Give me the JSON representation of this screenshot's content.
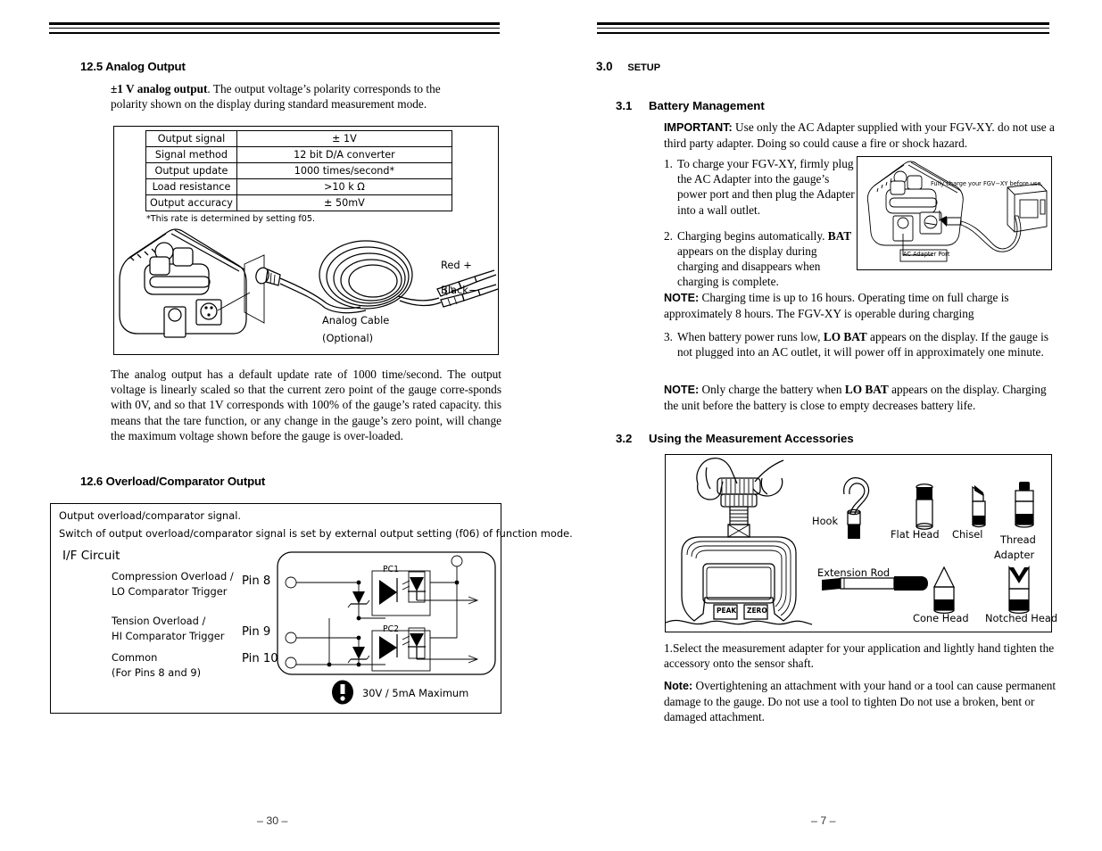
{
  "left_page": {
    "page_number": "– 30 –",
    "section_12_5": {
      "heading": "12.5 Analog Output",
      "intro_bold": "±1 V analog output",
      "intro_rest": ". The output voltage’s polarity corresponds to the polarity shown on the display during standard measurement mode.",
      "spec_table": {
        "rows": [
          {
            "label": "Output signal",
            "value": "± 1V"
          },
          {
            "label": "Signal method",
            "value": "12 bit D/A converter"
          },
          {
            "label": "Output update",
            "value": "1000 times/second*"
          },
          {
            "label": "Load resistance",
            "value": ">10 k Ω"
          },
          {
            "label": "Output accuracy",
            "value": "± 50mV"
          }
        ],
        "footnote": "*This rate is determined by setting f05."
      },
      "figure_labels": {
        "red": "Red +",
        "black": "Black−",
        "cable": "Analog Cable",
        "cable_opt": "(Optional)"
      },
      "paragraph": "The analog output has a default update rate of 1000 time/second. The output voltage is linearly scaled so that the current zero point of the gauge corre-sponds with 0V, and so that 1V corresponds with 100% of the gauge’s rated capacity. this means that the tare function, or any change in the gauge’s zero point, will change the maximum voltage shown before the gauge is over-loaded."
    },
    "section_12_6": {
      "heading": "12.6 Overload/Comparator Output",
      "figure": {
        "line1": "Output overload/comparator signal.",
        "line2": "Switch of output overload/comparator signal is set by external output setting (f06) of function mode.",
        "circuit_title": "I/F Circuit",
        "labels": [
          "Compression Overload /",
          "LO Comparator Trigger",
          "Tension Overload /",
          "HI Comparator Trigger",
          "Common",
          "(For Pins 8 and 9)"
        ],
        "pins": [
          "Pin 8",
          "Pin 9",
          "Pin 10"
        ],
        "opto": [
          "PC1",
          "PC2"
        ],
        "warning": "30V / 5mA Maximum"
      }
    }
  },
  "right_page": {
    "page_number": "– 7 –",
    "section_3_0": {
      "number": "3.0",
      "title": "Setup"
    },
    "section_3_1": {
      "number": "3.1",
      "title": "Battery Management",
      "important_label": "IMPORTANT:",
      "important_text": " Use only the AC Adapter supplied with your FGV-XY. do not use a third party adapter. Doing so could cause a fire or shock hazard.",
      "steps": [
        {
          "n": "1.",
          "text": "To charge your FGV-XY, firmly plug the AC Adapter into the gauge’s power port and then plug the Adapter into a wall outlet."
        },
        {
          "n": "2.",
          "text_pre": "Charging begins automatically. ",
          "bold": "BAT",
          "text_post": " appears on the display during charging and disappears when  charging is complete."
        }
      ],
      "note1_label": "NOTE:",
      "note1_text": " Charging time is up to 16 hours. Operating time on full charge is approximately 8 hours. The FGV-XY is operable during charging",
      "step3": {
        "n": "3.",
        "pre": "When battery power runs low, ",
        "bold": "LO BAT",
        "post": " appears on the display. If the gauge is not plugged into an AC outlet, it will power off in approximately one minute."
      },
      "note2_label": "NOTE:",
      "note2_pre": " Only charge the battery when ",
      "note2_bold": "LO BAT",
      "note2_post": " appears on the display. Charging the unit before the battery is close to empty decreases battery life.",
      "figure": {
        "caption": "Fully charge your FGV−XY before use.",
        "port_label": "AC Adapter Port"
      }
    },
    "section_3_2": {
      "number": "3.2",
      "title": "Using the Measurement Accessories",
      "figure": {
        "gauge_buttons": [
          "PEAK",
          "ZERO"
        ],
        "accessories": [
          "Hook",
          "Flat Head",
          "Chisel",
          "Thread",
          "Adapter",
          "Extension Rod",
          "Cone Head",
          "Notched Head"
        ]
      },
      "step1": "1.Select the measurement adapter for your application and lightly hand tighten the accessory onto the sensor shaft.",
      "note_label": "Note:",
      "note_text": " Overtightening an attachment with your hand  or a tool can cause permanent damage to the gauge. Do not use a tool to tighten Do not use a broken, bent or damaged attachment."
    }
  }
}
